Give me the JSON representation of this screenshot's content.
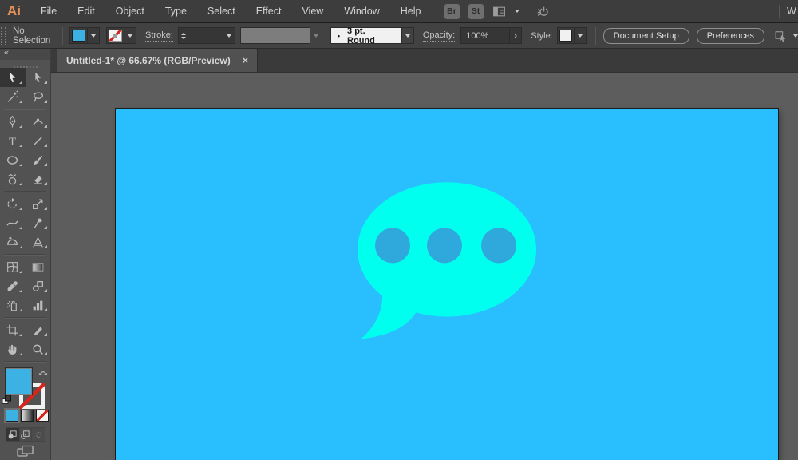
{
  "menu_bar": {
    "logo": "Ai",
    "items": [
      "File",
      "Edit",
      "Object",
      "Type",
      "Select",
      "Effect",
      "View",
      "Window",
      "Help"
    ],
    "bridge": "Br",
    "stock": "St",
    "workspace": "W"
  },
  "control_bar": {
    "selection_status": "No Selection",
    "stroke_label": "Stroke:",
    "brush_bullet": "•",
    "brush_style": "3 pt. Round",
    "opacity_label": "Opacity:",
    "opacity_value": "100%",
    "opacity_spinner": "›",
    "style_label": "Style:",
    "document_setup": "Document Setup",
    "preferences": "Preferences"
  },
  "tab": {
    "title": "Untitled-1* @ 66.67% (RGB/Preview)",
    "close": "×"
  },
  "toolbar": {
    "collapse": "«",
    "type_tool_glyph": "T",
    "tools": [
      "selection",
      "direct-selection",
      "magic-wand",
      "lasso",
      "pen",
      "curvature",
      "type",
      "line-segment",
      "ellipse",
      "paintbrush",
      "shaper",
      "eraser",
      "rotate",
      "scale",
      "width",
      "puppet-warp",
      "shape-builder",
      "perspective-grid",
      "mesh",
      "gradient",
      "eyedropper",
      "blend",
      "symbol-sprayer",
      "column-graph",
      "artboard",
      "slice",
      "hand",
      "zoom"
    ],
    "draw_modes": [
      "draw-normal",
      "draw-behind",
      "draw-inside"
    ]
  },
  "colors": {
    "artboard_blue": "#29BFFF",
    "bubble_cyan": "#00FFEF",
    "dot_blue": "#2FA9DC",
    "fill_swatch_blue": "#3BB2E3",
    "none_slash_red": "#D8251C",
    "logo_orange": "#E89159"
  }
}
